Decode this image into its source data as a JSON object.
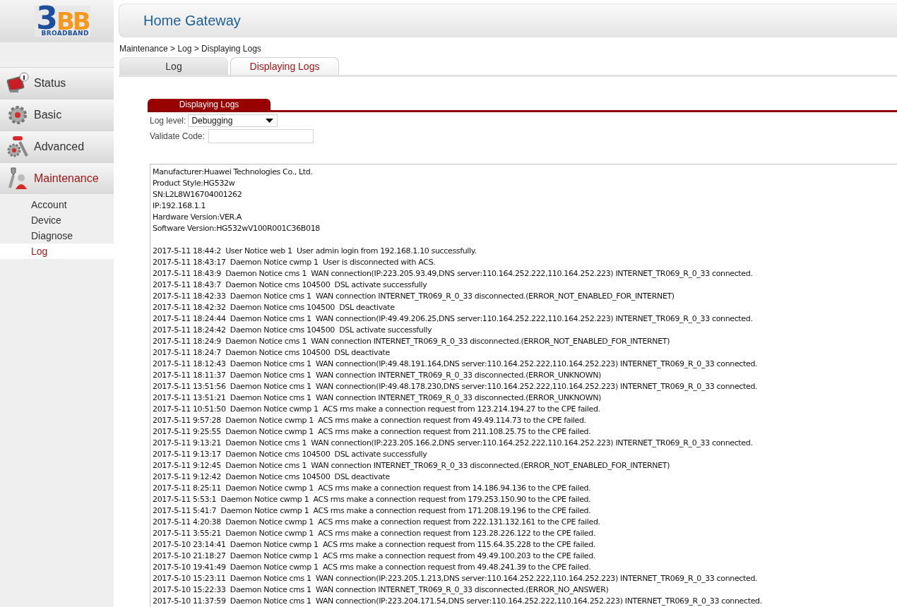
{
  "logo": {
    "numeral": "3",
    "letters": "BB",
    "tagline": "BROADBAND"
  },
  "header": {
    "title": "Home Gateway"
  },
  "breadcrumb": "Maintenance > Log > Displaying Logs",
  "tabs": [
    {
      "label": "Log",
      "selected": false
    },
    {
      "label": "Displaying Logs",
      "selected": true
    }
  ],
  "sidebar": {
    "items": [
      {
        "label": "Status",
        "kind": "status",
        "selected": false
      },
      {
        "label": "Basic",
        "kind": "basic",
        "selected": false
      },
      {
        "label": "Advanced",
        "kind": "advanced",
        "selected": false
      },
      {
        "label": "Maintenance",
        "kind": "maintenance",
        "selected": true,
        "children": [
          {
            "label": "Account",
            "selected": false
          },
          {
            "label": "Device",
            "selected": false
          },
          {
            "label": "Diagnose",
            "selected": false
          },
          {
            "label": "Log",
            "selected": true
          }
        ]
      }
    ]
  },
  "section": {
    "title": "Displaying Logs"
  },
  "form": {
    "log_level": {
      "label": "Log level:",
      "value": "Debugging"
    },
    "validate_code": {
      "label": "Validate Code:"
    }
  },
  "log": {
    "device_info": [
      "Manufacturer:Huawei Technologies Co., Ltd.",
      "Product Style:HG532w",
      "SN:L2L8W16704001262",
      "IP:192.168.1.1",
      "Hardware Version:VER.A",
      "Software Version:HG532wV100R001C36B018"
    ],
    "entries": [
      "2017-5-11 18:44:2  User Notice web 1  User admin login from 192.168.1.10 successfully.",
      "2017-5-11 18:43:17  Daemon Notice cwmp 1  User is disconnected with ACS.",
      "2017-5-11 18:43:9  Daemon Notice cms 1  WAN connection(IP:223.205.93.49,DNS server:110.164.252.222,110.164.252.223) INTERNET_TR069_R_0_33 connected.",
      "2017-5-11 18:43:7  Daemon Notice cms 104500  DSL activate successfully",
      "2017-5-11 18:42:33  Daemon Notice cms 1  WAN connection INTERNET_TR069_R_0_33 disconnected.(ERROR_NOT_ENABLED_FOR_INTERNET)",
      "2017-5-11 18:42:32  Daemon Notice cms 104500  DSL deactivate",
      "2017-5-11 18:24:44  Daemon Notice cms 1  WAN connection(IP:49.49.206.25,DNS server:110.164.252.222,110.164.252.223) INTERNET_TR069_R_0_33 connected.",
      "2017-5-11 18:24:42  Daemon Notice cms 104500  DSL activate successfully",
      "2017-5-11 18:24:9  Daemon Notice cms 1  WAN connection INTERNET_TR069_R_0_33 disconnected.(ERROR_NOT_ENABLED_FOR_INTERNET)",
      "2017-5-11 18:24:7  Daemon Notice cms 104500  DSL deactivate",
      "2017-5-11 18:12:43  Daemon Notice cms 1  WAN connection(IP:49.48.191.164,DNS server:110.164.252.222,110.164.252.223) INTERNET_TR069_R_0_33 connected.",
      "2017-5-11 18:11:37  Daemon Notice cms 1  WAN connection INTERNET_TR069_R_0_33 disconnected.(ERROR_UNKNOWN)",
      "2017-5-11 13:51:56  Daemon Notice cms 1  WAN connection(IP:49.48.178.230,DNS server:110.164.252.222,110.164.252.223) INTERNET_TR069_R_0_33 connected.",
      "2017-5-11 13:51:21  Daemon Notice cms 1  WAN connection INTERNET_TR069_R_0_33 disconnected.(ERROR_UNKNOWN)",
      "2017-5-11 10:51:50  Daemon Notice cwmp 1  ACS rms make a connection request from 123.214.194.27 to the CPE failed.",
      "2017-5-11 9:57:28  Daemon Notice cwmp 1  ACS rms make a connection request from 49.49.114.73 to the CPE failed.",
      "2017-5-11 9:25:55  Daemon Notice cwmp 1  ACS rms make a connection request from 211.108.25.75 to the CPE failed.",
      "2017-5-11 9:13:21  Daemon Notice cms 1  WAN connection(IP:223.205.166.2,DNS server:110.164.252.222,110.164.252.223) INTERNET_TR069_R_0_33 connected.",
      "2017-5-11 9:13:17  Daemon Notice cms 104500  DSL activate successfully",
      "2017-5-11 9:12:45  Daemon Notice cms 1  WAN connection INTERNET_TR069_R_0_33 disconnected.(ERROR_NOT_ENABLED_FOR_INTERNET)",
      "2017-5-11 9:12:42  Daemon Notice cms 104500  DSL deactivate",
      "2017-5-11 8:25:11  Daemon Notice cwmp 1  ACS rms make a connection request from 14.186.94.136 to the CPE failed.",
      "2017-5-11 5:53:1  Daemon Notice cwmp 1  ACS rms make a connection request from 179.253.150.90 to the CPE failed.",
      "2017-5-11 5:41:7  Daemon Notice cwmp 1  ACS rms make a connection request from 171.208.19.196 to the CPE failed.",
      "2017-5-11 4:20:38  Daemon Notice cwmp 1  ACS rms make a connection request from 222.131.132.161 to the CPE failed.",
      "2017-5-11 3:55:21  Daemon Notice cwmp 1  ACS rms make a connection request from 123.28.226.122 to the CPE failed.",
      "2017-5-10 23:14:41  Daemon Notice cwmp 1  ACS rms make a connection request from 115.64.35.228 to the CPE failed.",
      "2017-5-10 21:18:27  Daemon Notice cwmp 1  ACS rms make a connection request from 49.49.100.203 to the CPE failed.",
      "2017-5-10 19:41:49  Daemon Notice cwmp 1  ACS rms make a connection request from 49.48.241.39 to the CPE failed.",
      "2017-5-10 15:23:11  Daemon Notice cms 1  WAN connection(IP:223.205.1.213,DNS server:110.164.252.222,110.164.252.223) INTERNET_TR069_R_0_33 connected.",
      "2017-5-10 15:22:33  Daemon Notice cms 1  WAN connection INTERNET_TR069_R_0_33 disconnected.(ERROR_NO_ANSWER)",
      "2017-5-10 11:37:59  Daemon Notice cms 1  WAN connection(IP:223.204.171.54,DNS server:110.164.252.222,110.164.252.223) INTERNET_TR069_R_0_33 connected."
    ]
  }
}
